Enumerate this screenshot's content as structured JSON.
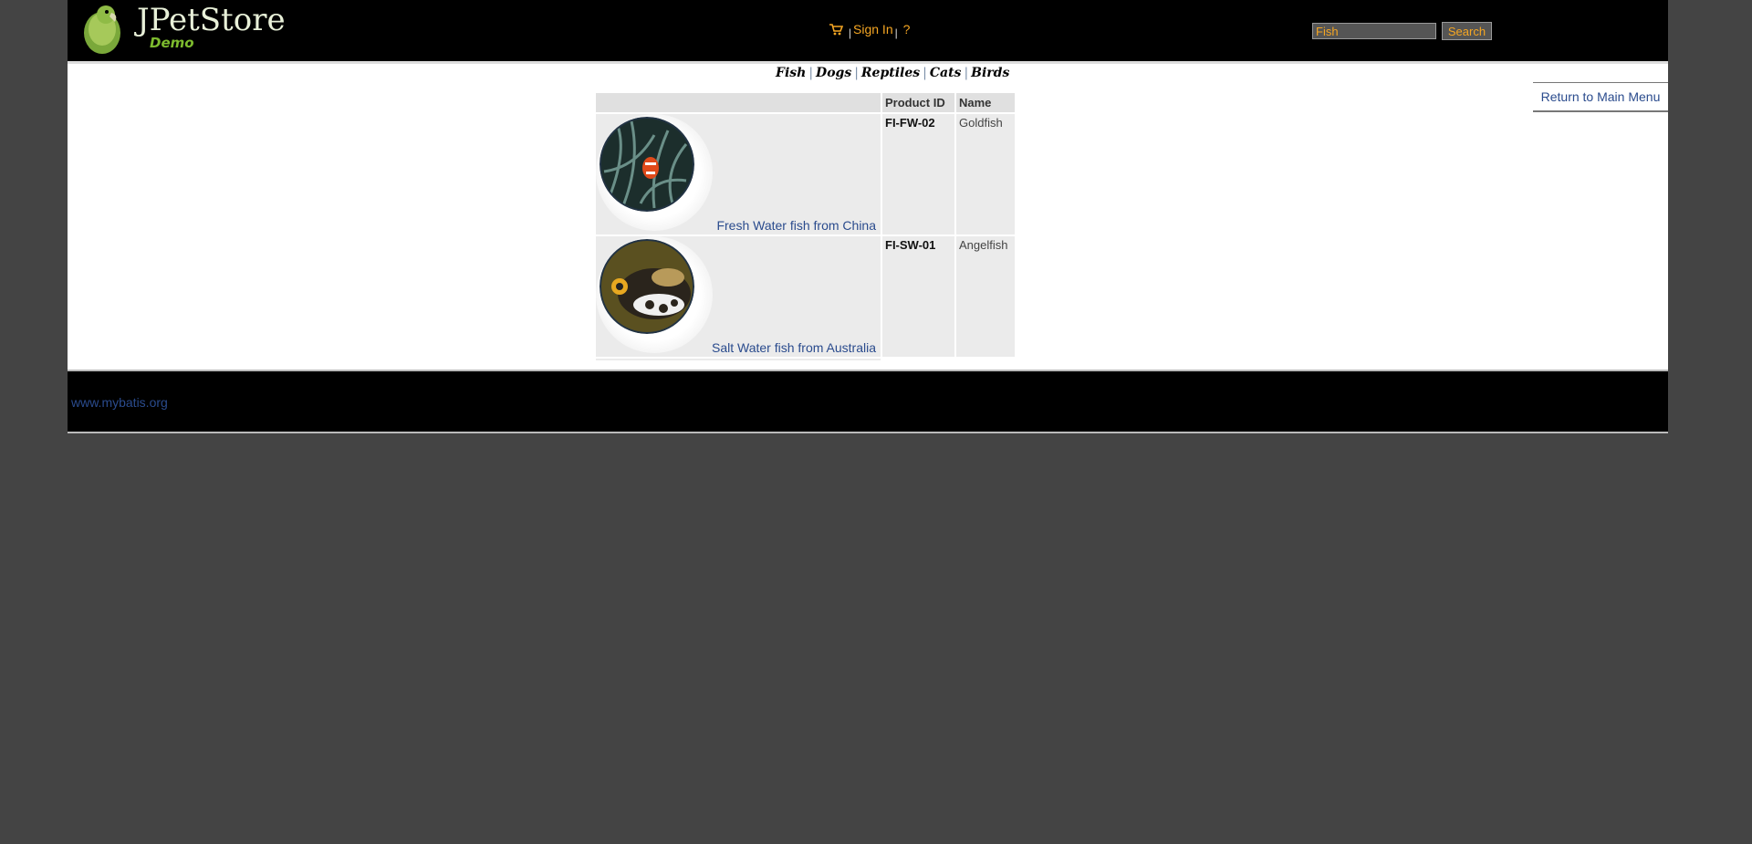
{
  "header": {
    "logo_title": "JPetStore",
    "logo_subtitle": "Demo",
    "menu": {
      "sign_in": "Sign In",
      "separator": "|",
      "help": "?"
    },
    "search": {
      "value": "Fish",
      "button": "Search"
    }
  },
  "quicklinks": [
    "Fish",
    "Dogs",
    "Reptiles",
    "Cats",
    "Birds"
  ],
  "back_link": "Return to Main Menu",
  "table": {
    "columns": [
      "",
      "Product ID",
      "Name"
    ],
    "rows": [
      {
        "description": "Fresh Water fish from China",
        "product_id": "FI-FW-02",
        "name": "Goldfish",
        "image": "clownfish"
      },
      {
        "description": "Salt Water fish from Australia",
        "product_id": "FI-SW-01",
        "name": "Angelfish",
        "image": "triggerfish"
      }
    ]
  },
  "footer": {
    "link": "www.mybatis.org"
  }
}
